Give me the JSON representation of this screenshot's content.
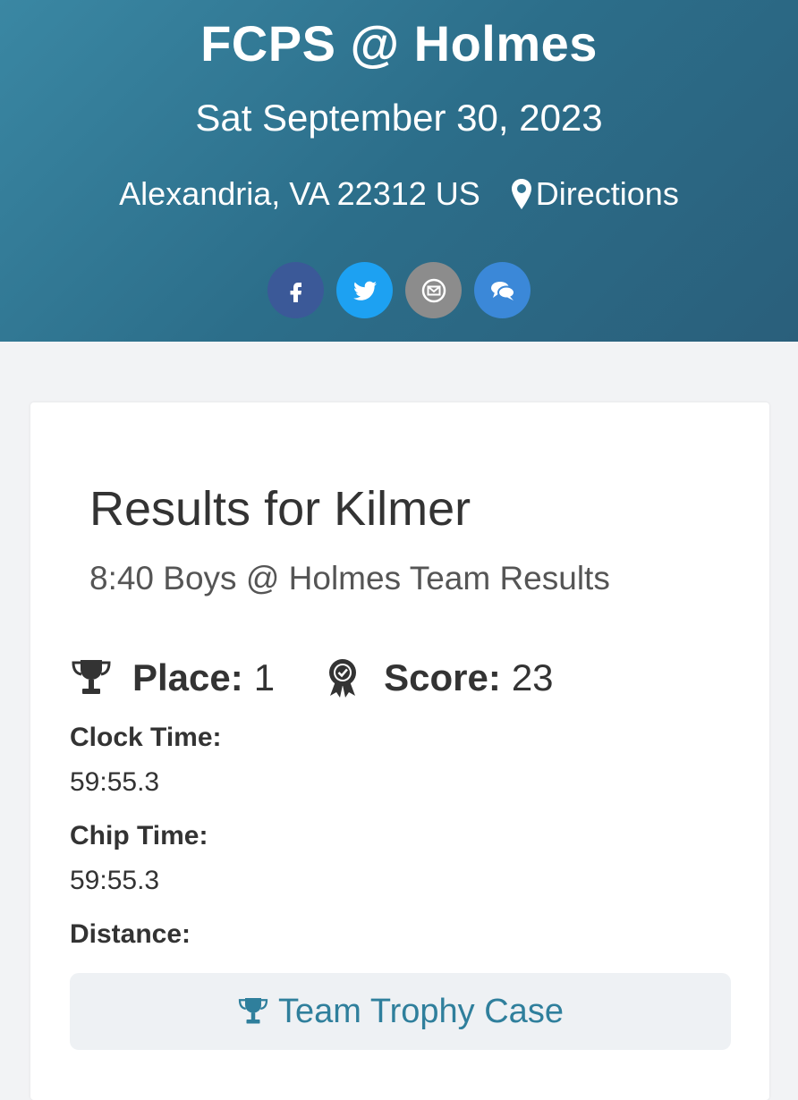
{
  "event": {
    "title": "FCPS @ Holmes",
    "date": "Sat September 30, 2023",
    "location": "Alexandria, VA 22312 US",
    "directions_label": "Directions"
  },
  "share": {
    "icons": [
      "facebook-icon",
      "twitter-icon",
      "email-icon",
      "comment-icon"
    ],
    "colors": {
      "facebook": "#3b5998",
      "twitter": "#1da1f2",
      "email": "#8c8c8c",
      "comment": "#3b88d8"
    }
  },
  "result": {
    "title": "Results for Kilmer",
    "subtitle": "8:40 Boys @ Holmes Team Results",
    "place_label": "Place:",
    "place_value": "1",
    "score_label": "Score:",
    "score_value": "23",
    "clock_label": "Clock Time:",
    "clock_value": "59:55.3",
    "chip_label": "Chip Time:",
    "chip_value": "59:55.3",
    "distance_label": "Distance:"
  },
  "trophy_button_label": "Team Trophy Case",
  "colors": {
    "accent": "#2f7f9c",
    "hero": "#337a96"
  }
}
